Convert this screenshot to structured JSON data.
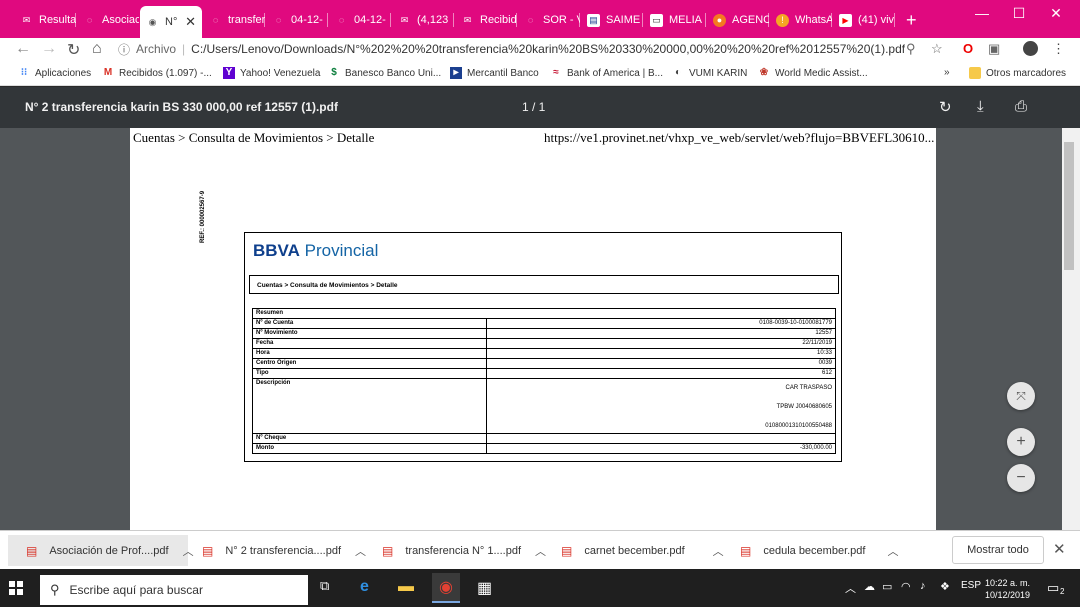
{
  "tabs": [
    {
      "title": "Resulta",
      "icon": "mail-icon",
      "color": "#ffffff"
    },
    {
      "title": "Asociac",
      "icon": "globe-icon",
      "color": "#ffffff"
    },
    {
      "title": "N° :",
      "icon": "globe-icon",
      "color": "#333333",
      "active": true
    },
    {
      "title": "transfer",
      "icon": "globe-icon",
      "color": "#ffffff"
    },
    {
      "title": "04-12-",
      "icon": "globe-icon",
      "color": "#ffffff"
    },
    {
      "title": "04-12-",
      "icon": "globe-icon",
      "color": "#ffffff"
    },
    {
      "title": "(4,123",
      "icon": "mail-icon",
      "color": "#ffffff"
    },
    {
      "title": "Recibid",
      "icon": "mail-icon",
      "color": "#ffffff"
    },
    {
      "title": "SOR - V",
      "icon": "globe-icon",
      "color": "#ffffff"
    },
    {
      "title": "SAIME",
      "icon": "saime-icon",
      "color": "#ffffff"
    },
    {
      "title": "MELIA",
      "icon": "melia-icon",
      "color": "#ffffff"
    },
    {
      "title": "AGENC",
      "icon": "agency-icon",
      "color": "#ffffff"
    },
    {
      "title": "WhatsA",
      "icon": "whatsapp-icon",
      "color": "#ffffff"
    },
    {
      "title": "(41) viv",
      "icon": "youtube-icon",
      "color": "#ffffff"
    }
  ],
  "toolbar": {
    "site_label": "Archivo",
    "url": "C:/Users/Lenovo/Downloads/N°%202%20%20transferencia%20karin%20BS%20330%20000,00%20%20%20ref%2012557%20(1).pdf"
  },
  "bookmarks": [
    {
      "label": "Aplicaciones",
      "icon": "apps-icon"
    },
    {
      "label": "Recibidos (1.097) -...",
      "icon": "gmail-icon"
    },
    {
      "label": "Yahoo! Venezuela",
      "icon": "yahoo-icon"
    },
    {
      "label": "Banesco Banco Uni...",
      "icon": "banesco-icon"
    },
    {
      "label": "Mercantil Banco",
      "icon": "mercantil-icon"
    },
    {
      "label": "Bank of America | B...",
      "icon": "boa-icon"
    },
    {
      "label": "VUMI KARIN",
      "icon": "globe-icon"
    },
    {
      "label": "World Medic Assist...",
      "icon": "wma-icon"
    }
  ],
  "bookmarks_more": "»",
  "bookmarks_other": "Otros marcadores",
  "pdf": {
    "title": "N° 2 transferencia karin BS 330 000,00 ref 12557 (1).pdf",
    "page_indicator": "1 / 1",
    "header_left": "Cuentas > Consulta de Movimientos > Detalle",
    "header_right": "https://ve1.provinet.net/vhxp_ve_web/servlet/web?flujo=BBVEFL30610...",
    "side_ref": "REF.: 000002567-9",
    "logo_bold": "BBVA",
    "logo_rest": " Provincial",
    "breadcrumb": "Cuentas > Consulta de Movimientos > Detalle",
    "summary_title": "Resumen",
    "rows": [
      {
        "label": "Nº de Cuenta",
        "value": "0108-0039-10-0100081779"
      },
      {
        "label": "Nº Movimiento",
        "value": "12557"
      },
      {
        "label": "Fecha",
        "value": "22/11/2019"
      },
      {
        "label": "Hora",
        "value": "10:33"
      },
      {
        "label": "Centro Origen",
        "value": "0039"
      },
      {
        "label": "Tipo",
        "value": "612"
      }
    ],
    "description_label": "Descripción",
    "description_lines": [
      "CAR TRASPASO",
      "TPBW J0040680605",
      "01080001310100550488"
    ],
    "cheque_label": "Nº Cheque",
    "cheque_value": "",
    "amount_label": "Monto",
    "amount_value": "-330,000.00"
  },
  "downloads": [
    {
      "name": "Asociación de Prof....pdf"
    },
    {
      "name": "N° 2  transferencia....pdf"
    },
    {
      "name": "transferencia  N° 1....pdf"
    },
    {
      "name": "carnet becember.pdf"
    },
    {
      "name": "cedula becember.pdf"
    }
  ],
  "downloads_show_all": "Mostrar todo",
  "taskbar": {
    "search_placeholder": "Escribe aquí para buscar",
    "language": "ESP",
    "time": "10:22 a. m.",
    "date": "10/12/2019",
    "notification_count": "2"
  },
  "colors": {
    "tab_bar": "#e0097f",
    "pdf_toolbar": "#323639",
    "viewer_bg": "#525659",
    "bbva_blue": "#1464a5"
  }
}
